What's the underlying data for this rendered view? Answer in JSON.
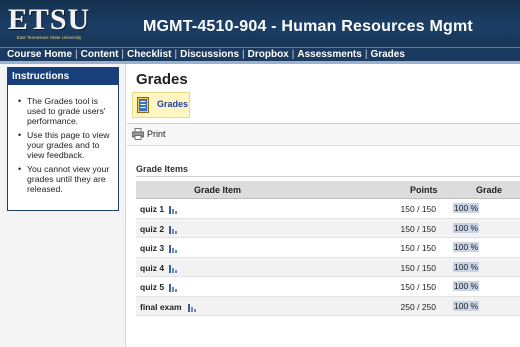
{
  "header": {
    "logo_text": "ETSU",
    "logo_subtext": "East Tennessee State University",
    "course_title": "MGMT-4510-904 - Human Resources Mgmt"
  },
  "nav": {
    "items": [
      "Course Home",
      "Content",
      "Checklist",
      "Discussions",
      "Dropbox",
      "Assessments",
      "Grades"
    ]
  },
  "sidebar": {
    "title": "Instructions",
    "items": [
      "The Grades tool is used to grade users' performance.",
      "Use this page to view your grades and to view feedback.",
      "You cannot view your grades until they are released."
    ]
  },
  "main": {
    "title": "Grades",
    "tab_label": "Grades",
    "print_label": "Print",
    "section_title": "Grade Items",
    "columns": {
      "item": "Grade Item",
      "points": "Points",
      "grade": "Grade"
    },
    "rows": [
      {
        "name": "quiz 1",
        "points": "150 / 150",
        "grade": "100 %"
      },
      {
        "name": "quiz 2",
        "points": "150 / 150",
        "grade": "100 %"
      },
      {
        "name": "quiz 3",
        "points": "150 / 150",
        "grade": "100 %"
      },
      {
        "name": "quiz 4",
        "points": "150 / 150",
        "grade": "100 %"
      },
      {
        "name": "quiz 5",
        "points": "150 / 150",
        "grade": "100 %"
      },
      {
        "name": "final exam",
        "points": "250 / 250",
        "grade": "100 %"
      }
    ]
  },
  "colors": {
    "header_bg": "#1c3f66",
    "sidebar_title_bg": "#17407b",
    "tab_highlight": "#fff6c3",
    "grade_highlight": "#c9d4e6"
  },
  "icons": {
    "grades_tab": "grades-book-icon",
    "print": "printer-icon",
    "stats": "stats-bars-icon"
  }
}
